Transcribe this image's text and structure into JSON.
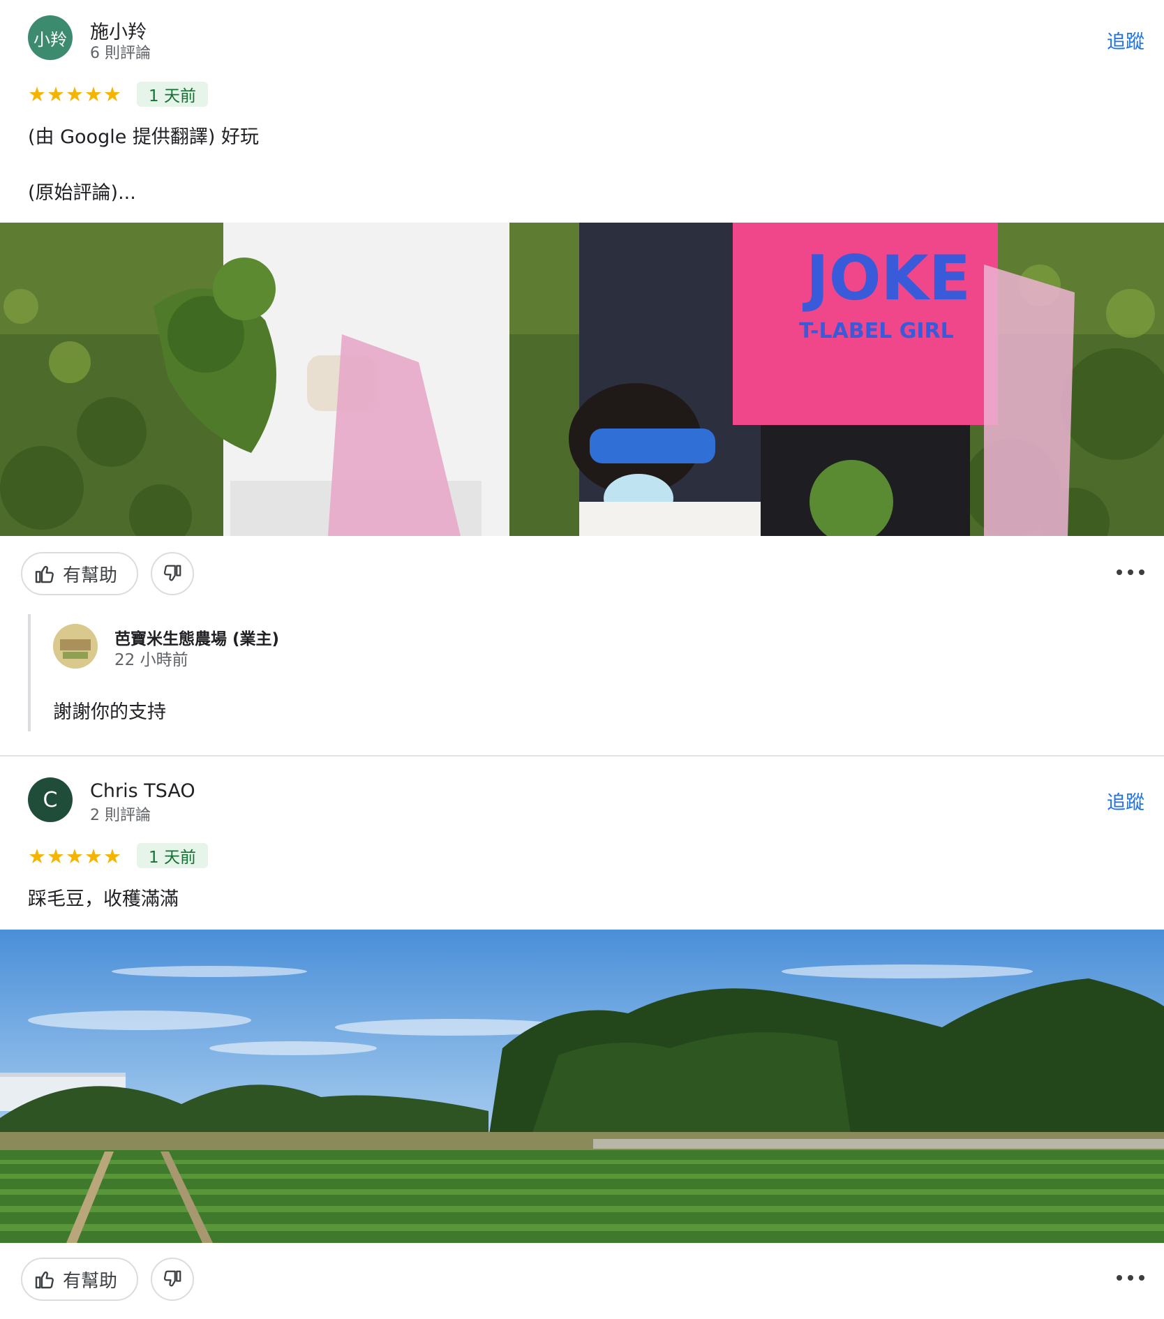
{
  "reviews": [
    {
      "avatar_text": "小羚",
      "name": "施小羚",
      "review_count": "6 則評論",
      "follow_label": "追蹤",
      "rating": 5,
      "date": "1 天前",
      "text_line1": "(由 Google 提供翻譯) 好玩",
      "text_line2": "(原始評論)...",
      "photo_text_1": "JOKE",
      "photo_text_2": "T-LABEL GIRL",
      "helpful_label": "有幫助",
      "owner_reply": {
        "name": "芭寶米生態農場 (業主)",
        "time": "22 小時前",
        "text": "謝謝你的支持"
      }
    },
    {
      "avatar_text": "C",
      "name": "Chris TSAO",
      "review_count": "2 則評論",
      "follow_label": "追蹤",
      "rating": 5,
      "date": "1 天前",
      "text_line1": "踩毛豆，收穫滿滿",
      "helpful_label": "有幫助"
    }
  ],
  "colors": {
    "star": "#f4b400",
    "follow": "#1a73e8",
    "badge_bg": "#e6f4ea",
    "badge_text": "#137333"
  }
}
